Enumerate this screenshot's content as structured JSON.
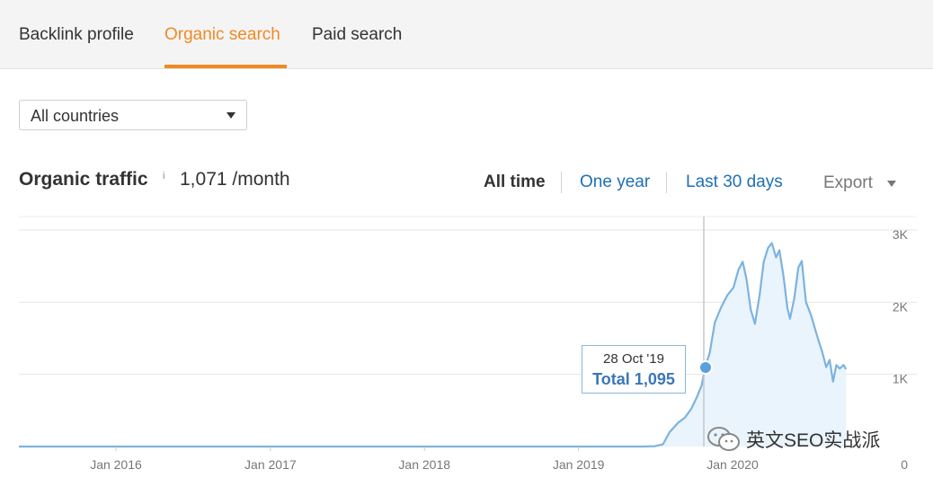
{
  "tabs": [
    {
      "label": "Backlink profile",
      "active": false
    },
    {
      "label": "Organic search",
      "active": true
    },
    {
      "label": "Paid search",
      "active": false
    }
  ],
  "country_select": {
    "value": "All countries"
  },
  "metric": {
    "title": "Organic traffic",
    "info": "i",
    "value": "1,071 /month"
  },
  "ranges": [
    "All time",
    "One year",
    "Last 30 days"
  ],
  "selected_range": "All time",
  "export_label": "Export",
  "tooltip": {
    "date": "28 Oct '19",
    "total": "Total 1,095"
  },
  "watermark": {
    "text": "英文SEO实战派",
    "icon": "wechat-icon"
  },
  "colors": {
    "accent": "#f08a24",
    "link": "#1f6fb5",
    "line": "#7db3df",
    "fill": "#eaf4fc",
    "marker": "#5aa0dc"
  },
  "chart_data": {
    "type": "area",
    "x_tick_labels": [
      "Jan 2016",
      "Jan 2017",
      "Jan 2018",
      "Jan 2019",
      "Jan 2020"
    ],
    "y_tick_labels": [
      "3K",
      "2K",
      "1K",
      "0"
    ],
    "ylim": [
      0,
      3000
    ],
    "grid": true,
    "series": [
      {
        "points": [
          [
            "2015-09-01",
            0
          ],
          [
            "2019-06-01",
            0
          ],
          [
            "2019-07-01",
            5
          ],
          [
            "2019-07-20",
            30
          ],
          [
            "2019-08-05",
            200
          ],
          [
            "2019-08-25",
            330
          ],
          [
            "2019-09-10",
            400
          ],
          [
            "2019-09-25",
            520
          ],
          [
            "2019-10-08",
            680
          ],
          [
            "2019-10-20",
            850
          ],
          [
            "2019-10-28",
            1095
          ],
          [
            "2019-11-08",
            1300
          ],
          [
            "2019-11-20",
            1720
          ],
          [
            "2019-12-05",
            1930
          ],
          [
            "2019-12-20",
            2100
          ],
          [
            "2020-01-03",
            2200
          ],
          [
            "2020-01-15",
            2450
          ],
          [
            "2020-01-25",
            2560
          ],
          [
            "2020-02-03",
            2320
          ],
          [
            "2020-02-13",
            1900
          ],
          [
            "2020-02-23",
            1700
          ],
          [
            "2020-03-05",
            2100
          ],
          [
            "2020-03-15",
            2560
          ],
          [
            "2020-03-25",
            2750
          ],
          [
            "2020-04-03",
            2820
          ],
          [
            "2020-04-13",
            2620
          ],
          [
            "2020-04-21",
            2720
          ],
          [
            "2020-05-01",
            2350
          ],
          [
            "2020-05-10",
            1920
          ],
          [
            "2020-05-16",
            1770
          ],
          [
            "2020-05-26",
            2050
          ],
          [
            "2020-06-05",
            2480
          ],
          [
            "2020-06-13",
            2570
          ],
          [
            "2020-06-23",
            2000
          ],
          [
            "2020-07-05",
            1820
          ],
          [
            "2020-07-20",
            1520
          ],
          [
            "2020-08-01",
            1300
          ],
          [
            "2020-08-10",
            1100
          ],
          [
            "2020-08-18",
            1200
          ],
          [
            "2020-08-26",
            900
          ],
          [
            "2020-09-03",
            1130
          ],
          [
            "2020-09-11",
            1080
          ],
          [
            "2020-09-20",
            1130
          ],
          [
            "2020-09-26",
            1071
          ]
        ]
      }
    ],
    "highlight": {
      "date": "2019-10-28",
      "value": 1095
    }
  }
}
